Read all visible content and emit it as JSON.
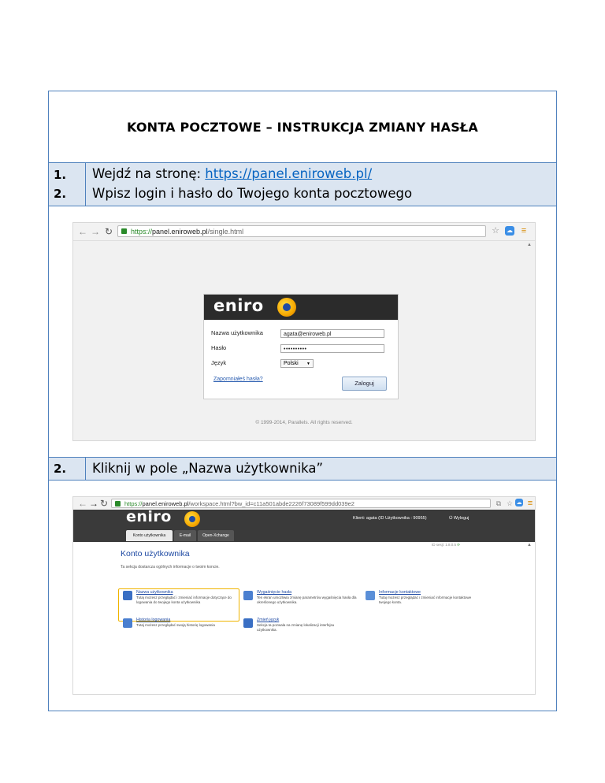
{
  "title": "KONTA POCZTOWE – INSTRUKCJA ZMIANY HASŁA",
  "steps_block1": {
    "num1": "1.",
    "num2": "2.",
    "line1_prefix": "Wejdź na stronę: ",
    "line1_link": "https://panel.eniroweb.pl/",
    "line2": "Wpisz login i hasło do Twojego konta pocztowego"
  },
  "shot1": {
    "url_https": "https://",
    "url_host": "panel.eniroweb.pl",
    "url_path": "/single.html",
    "logo": "eniro",
    "username_label": "Nazwa użytkownika",
    "username_value": "agata@eniroweb.pl",
    "password_label": "Hasło",
    "password_value": "••••••••••",
    "language_label": "Język",
    "language_value": "Polski",
    "forgot_link": "Zapomniałeś hasła?",
    "login_button": "Zaloguj",
    "copyright": "© 1999-2014, Parallels. All rights reserved."
  },
  "steps_block2": {
    "num": "2.",
    "text": "Kliknij w pole „Nazwa użytkownika”"
  },
  "shot2": {
    "url_https": "https://",
    "url_host": "panel.eniroweb.pl",
    "url_path": "/workspace.html?bw_id=c11a501abde2226f73089f599dd039e2",
    "logo": "eniro",
    "client_info": "Klient: agata (ID Użytkownika : 90955)",
    "logout": "Wyloguj",
    "tabs": [
      "Konto użytkownika",
      "E-mail",
      "Open-Xchange"
    ],
    "page_heading": "Konto użytkownika",
    "section_desc": "Ta sekcja dostarcza ogólnych informacje o twoim koncie.",
    "system_info": "ID sesji: 1.8.0.5",
    "features": [
      {
        "title": "Nazwa użytkownika",
        "desc": "Tutaj możesz przeglądać i zmieniać informacje dotyczące do logowania do twojego konta użytkownika"
      },
      {
        "title": "Wygaśnięcie hasła",
        "desc": "Ten ekran umożliwia zmianę parametrów wygaśnięcia hasła dla określonego użytkownika."
      },
      {
        "title": "Informacje kontaktowe",
        "desc": "Tutaj możesz przeglądać i zmieniać informacje kontaktowe twojego konta."
      },
      {
        "title": "Historia logowania",
        "desc": "Tutaj możesz przeglądać swoją historię logowania"
      },
      {
        "title": "Zmień język",
        "desc": "Sekcja ta pozwala na zmianę lokalizacji interfejsu użytkownika."
      }
    ]
  },
  "colors": {
    "border": "#4f81bd",
    "step_bg": "#dbe5f1",
    "link": "#0563c1",
    "highlight": "#f0b400"
  }
}
